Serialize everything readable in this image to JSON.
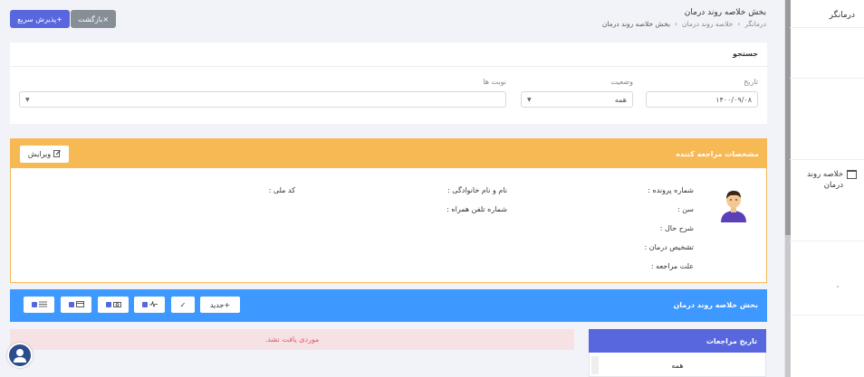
{
  "sidebar": {
    "brand": "درمانگر",
    "items": [
      {
        "label": "خلاصه روند درمان",
        "icon": "archive-icon"
      }
    ]
  },
  "header": {
    "title": "بخش خلاصه روند درمان",
    "breadcrumbs": [
      "درمانگر",
      "خلاصه روند درمان",
      "بخش خلاصه روند درمان"
    ],
    "breadcrumb_sep": "›",
    "back_label": "×بازگشت",
    "quick_label": "+پذیرش سریع"
  },
  "search": {
    "title": "جستجو",
    "date_label": "تاریخ",
    "date_value": "۱۴۰۰/۰۹/۰۸",
    "status_label": "وضعیت",
    "status_value": "همه",
    "shifts_label": "نوبت ها",
    "shifts_value": ""
  },
  "patient": {
    "title": "مشخصات مراجعه کننده",
    "edit_label": "ویرایش",
    "fields": {
      "file_number": "شماره پرونده :",
      "age": "سن :",
      "history": "شرح حال :",
      "diagnosis": "تشخیص درمان :",
      "reason": "علت مراجعه :",
      "full_name": "نام و نام خانوادگی :",
      "mobile": "شماره تلفن همراه :",
      "national_code": "کد ملی :"
    }
  },
  "treatment": {
    "title": "بخش خلاصه روند درمان",
    "new_label": "+جدید",
    "check_label": "✓"
  },
  "alert": {
    "text": "موردی یافت نشد."
  },
  "history": {
    "title": "تاریخ مراجعات",
    "options": [
      "همه"
    ]
  },
  "colors": {
    "primary": "#5867dd",
    "warning": "#f6b954",
    "info": "#3d98ff",
    "danger_bg": "#f6e1e4",
    "danger_text": "#e05b6c",
    "secondary": "#868e96"
  }
}
